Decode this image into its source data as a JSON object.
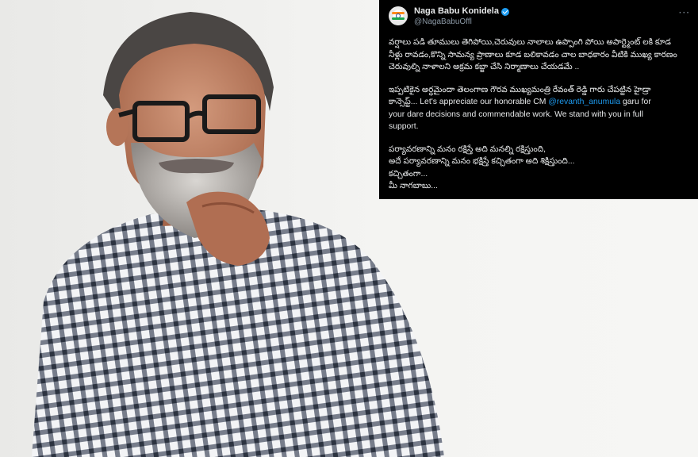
{
  "tweet": {
    "author_name": "Naga Babu Konidela",
    "handle": "@NagaBabuOffl",
    "more_label": "···",
    "paragraph1": [
      "వర్షాలు పడి తూములు తెగిపోయి,చెరువులు నాలాలు ఉప్పొంగి పోయి అపార్ట్మెంట్ లకి కూడ",
      "నీళ్లు రావడం,కొన్ని సామన్య ప్రాణాలు కూడ బలికావడం చాల బాధకారం వీటికి ముఖ్య కారణం",
      "చెరువుల్ని నాళాలని అక్రమ కబ్జా చేసి నిర్మాణాలు చేయడమే .."
    ],
    "paragraph2_line1": "ఇప్పటికైన అర్ధమైందా తెలంగాణ గౌరవ ముఖ్యమంత్రి రేవంత్ రెడ్డి గారు చేపట్టిన హైడ్రా",
    "paragraph2_line2_prefix": "కాన్సెప్ట్... Let's appreciate our honorable CM ",
    "mention": "@revanth_anumula",
    "paragraph2_line2_suffix": " garu for",
    "paragraph2_line3": "your dare decisions and commendable work. We stand with you in full",
    "paragraph2_line4": "support.",
    "paragraph3": [
      "పర్యావరణాన్ని మనం రక్షిస్తే అది మనల్ని రక్షిస్తుంది,",
      "అదే పర్యావరణాన్ని మనం భక్షిస్తే కచ్చితంగా అది శిక్షిస్తుంది...",
      "కచ్చితంగా...",
      "మీ నాగబాబు..."
    ]
  },
  "colors": {
    "card_background": "#000000",
    "mention_blue": "#1d9bf0",
    "verified_badge": "#1d9bf0"
  }
}
